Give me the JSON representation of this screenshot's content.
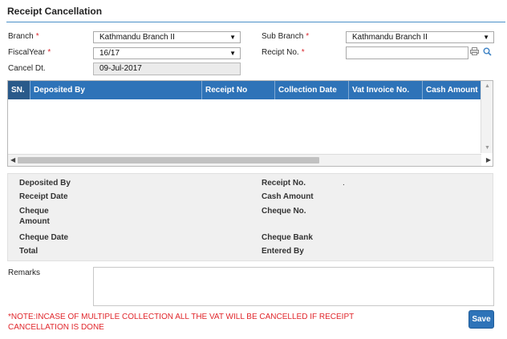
{
  "page": {
    "title": "Receipt Cancellation"
  },
  "form": {
    "branch": {
      "label": "Branch",
      "required": "*",
      "value": "Kathmandu Branch II"
    },
    "sub_branch": {
      "label": "Sub Branch",
      "required": "*",
      "value": "Kathmandu Branch II"
    },
    "fiscal_year": {
      "label": "FiscalYear",
      "required": "*",
      "value": "16/17"
    },
    "receipt_no": {
      "label": "Recipt No.",
      "required": "*",
      "value": ""
    },
    "cancel_dt": {
      "label": "Cancel Dt.",
      "value": "09-Jul-2017"
    }
  },
  "grid": {
    "columns": [
      "SN.",
      "Deposited By",
      "Receipt No",
      "Collection Date",
      "Vat Invoice No.",
      "Cash Amount"
    ],
    "rows": []
  },
  "details": {
    "deposited_by": "Deposited By",
    "receipt_date": "Receipt Date",
    "cheque_amount_1": "Cheque",
    "cheque_amount_2": "Amount",
    "cheque_date": "Cheque Date",
    "total": "Total",
    "receipt_no": "Receipt No.",
    "receipt_no_value": ".",
    "cash_amount": "Cash Amount",
    "cheque_no": "Cheque No.",
    "cheque_bank": "Cheque Bank",
    "entered_by": "Entered By"
  },
  "remarks": {
    "label": "Remarks",
    "value": ""
  },
  "note": "*NOTE:INCASE OF MULTIPLE COLLECTION ALL THE VAT WILL BE CANCELLED IF RECEIPT CANCELLATION IS DONE",
  "actions": {
    "save_label": "Save"
  },
  "icons": {
    "dropdown": "▼",
    "printer": "printer-icon",
    "search": "search-icon"
  },
  "colors": {
    "accent": "#2e73b8",
    "required": "#d9262c",
    "note": "#e0262b"
  }
}
